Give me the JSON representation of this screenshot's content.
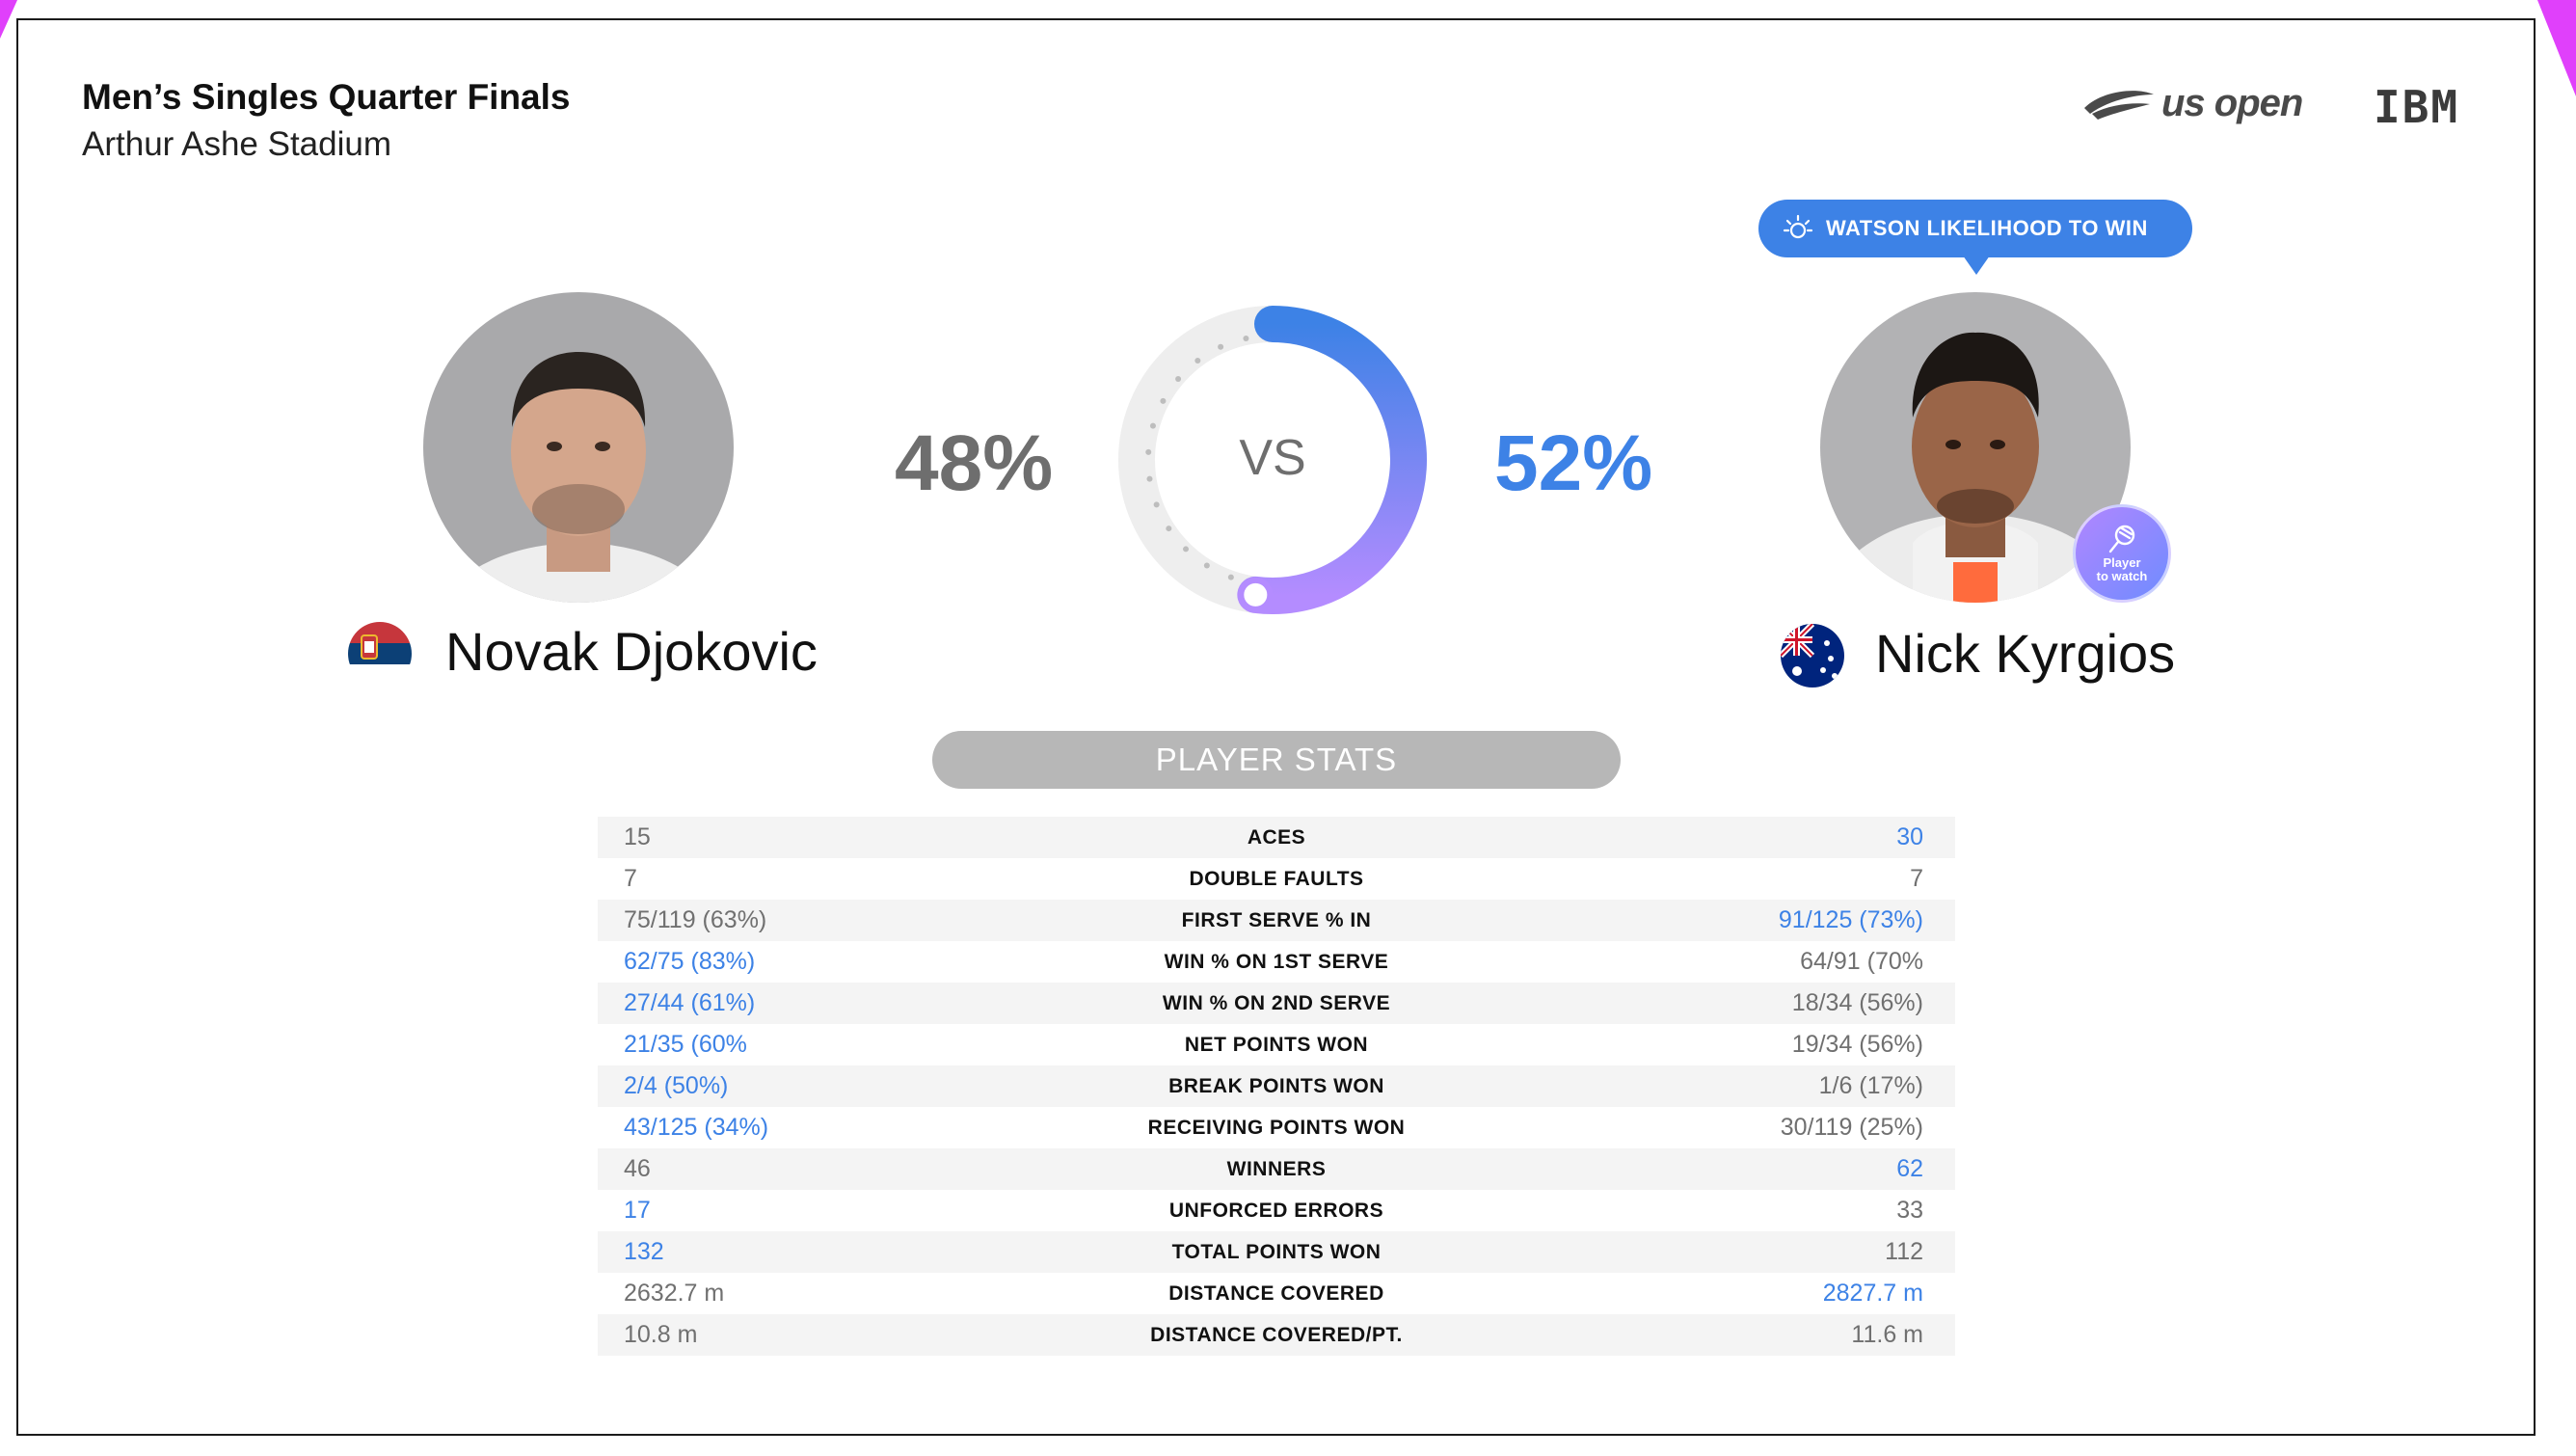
{
  "header": {
    "match_title": "Men’s Singles Quarter Finals",
    "venue": "Arthur Ashe Stadium"
  },
  "logos": {
    "usopen_wordmark": "us open",
    "ibm_wordmark": "IBM"
  },
  "watson": {
    "label": "WATSON LIKELIHOOD TO WIN",
    "badge_line1": "Player",
    "badge_line2": "to watch"
  },
  "players": {
    "left": {
      "name": "Novak Djokovic",
      "likelihood": "48%",
      "likelihood_value": 48
    },
    "right": {
      "name": "Nick Kyrgios",
      "likelihood": "52%",
      "likelihood_value": 52
    }
  },
  "vs_label": "VS",
  "stats_title": "PLAYER STATS",
  "stats": [
    {
      "label": "ACES",
      "left": "15",
      "right": "30",
      "winner": "right"
    },
    {
      "label": "DOUBLE FAULTS",
      "left": "7",
      "right": "7",
      "winner": "none"
    },
    {
      "label": "FIRST SERVE % IN",
      "left": "75/119 (63%)",
      "right": "91/125 (73%)",
      "winner": "right"
    },
    {
      "label": "WIN % ON 1ST SERVE",
      "left": "62/75 (83%)",
      "right": "64/91 (70%",
      "winner": "left"
    },
    {
      "label": "WIN % ON 2ND SERVE",
      "left": "27/44 (61%)",
      "right": "18/34 (56%)",
      "winner": "left"
    },
    {
      "label": "NET POINTS WON",
      "left": "21/35 (60%",
      "right": "19/34 (56%)",
      "winner": "left"
    },
    {
      "label": "BREAK POINTS WON",
      "left": "2/4 (50%)",
      "right": "1/6 (17%)",
      "winner": "left"
    },
    {
      "label": "RECEIVING POINTS WON",
      "left": "43/125 (34%)",
      "right": "30/119 (25%)",
      "winner": "left"
    },
    {
      "label": "WINNERS",
      "left": "46",
      "right": "62",
      "winner": "right"
    },
    {
      "label": "UNFORCED ERRORS",
      "left": "17",
      "right": "33",
      "winner": "left"
    },
    {
      "label": "TOTAL POINTS WON",
      "left": "132",
      "right": "112",
      "winner": "left"
    },
    {
      "label": "DISTANCE COVERED",
      "left": "2632.7 m",
      "right": "2827.7 m",
      "winner": "right"
    },
    {
      "label": "DISTANCE COVERED/PT.",
      "left": "10.8 m",
      "right": "11.6 m",
      "winner": "none"
    }
  ],
  "colors": {
    "accent_blue": "#3d82e6",
    "accent_purple": "#a58bff",
    "muted_text": "#707070",
    "corner_magenta": "#e040fb"
  }
}
